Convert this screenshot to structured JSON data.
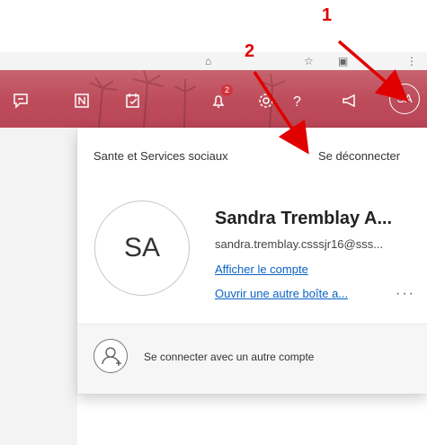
{
  "annotations": {
    "label_1": "1",
    "label_2": "2"
  },
  "toolbar": {
    "notification_count": "2",
    "avatar_initials": "SA",
    "accent_color": "#be4d5c"
  },
  "account_panel": {
    "organization": "Sante et Services sociaux",
    "sign_out": "Se déconnecter",
    "avatar_initials": "SA",
    "user_name": "Sandra Tremblay A...",
    "user_email": "sandra.tremblay.csssjr16@sss...",
    "view_account": "Afficher le compte",
    "open_other_mailbox": "Ouvrir une autre boîte a...",
    "more": "···",
    "add_account": "Se connecter avec un autre compte"
  },
  "icons": [
    "feedback-icon",
    "onenote-icon",
    "tasks-icon",
    "bell-icon",
    "gear-icon",
    "help-icon",
    "megaphone-icon",
    "add-person-icon"
  ]
}
